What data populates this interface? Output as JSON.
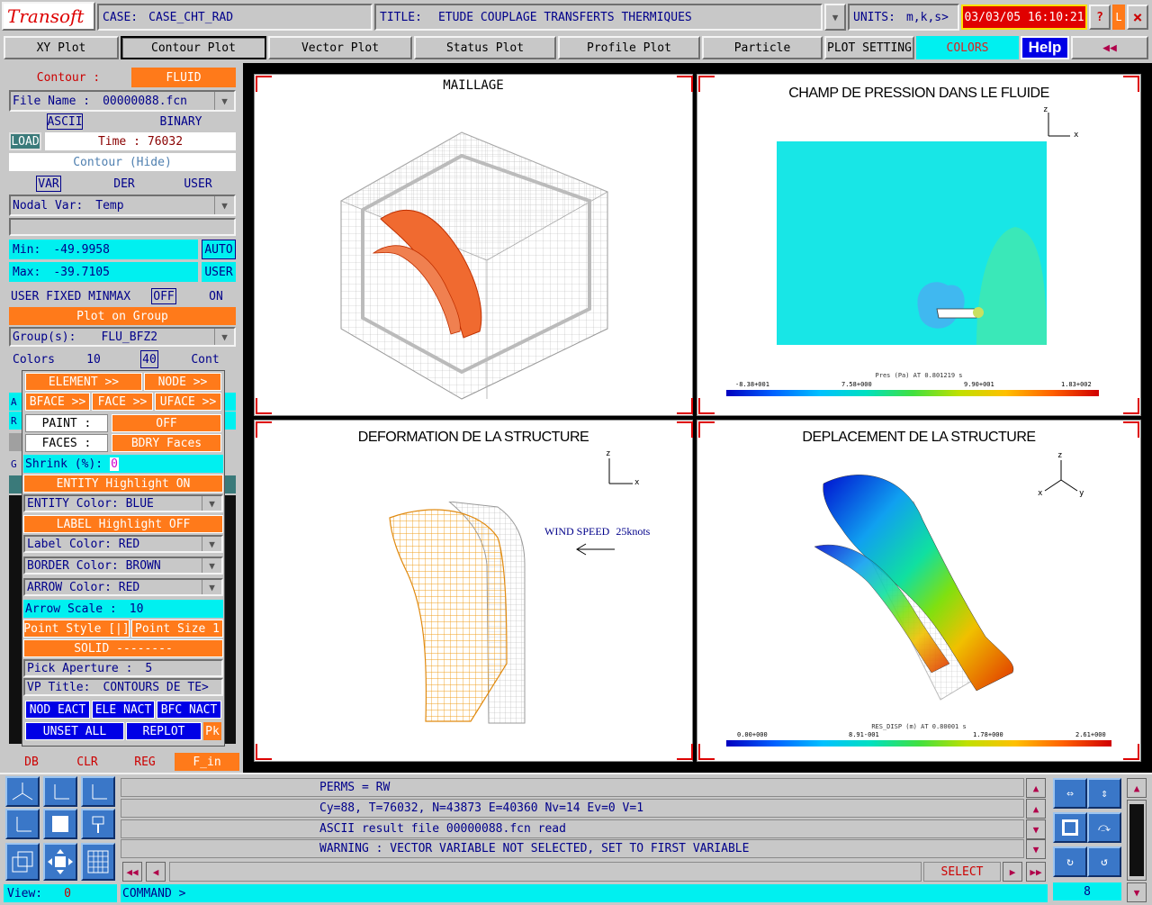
{
  "header": {
    "logo": "Transoft",
    "case_label": "CASE:",
    "case_value": "CASE_CHT_RAD",
    "title_label": "TITLE:",
    "title_value": "ETUDE COUPLAGE TRANSFERTS THERMIQUES",
    "units_label": "UNITS:",
    "units_value": "m,k,s>",
    "datetime": "03/03/05 16:10:21",
    "help_q": "?",
    "l_btn": "L",
    "close": "×"
  },
  "toolbar": {
    "tabs": [
      "XY Plot",
      "Contour Plot",
      "Vector Plot",
      "Status Plot",
      "Profile Plot",
      "Particle",
      "PLOT SETTING",
      "COLORS"
    ],
    "help": "Help",
    "back": "◀◀"
  },
  "left": {
    "contour_label": "Contour :",
    "contour_value": "FLUID",
    "file_label": "File Name :",
    "file_value": "00000088.fcn",
    "ascii": "ASCII",
    "binary": "BINARY",
    "load": "LOAD",
    "time_label": "Time :",
    "time_value": "76032",
    "contour_hide": "Contour (Hide)",
    "var": "VAR",
    "der": "DER",
    "user": "USER",
    "nodal_label": "Nodal Var:",
    "nodal_value": "Temp",
    "min_label": "Min:",
    "min_value": "-49.9958",
    "auto": "AUTO",
    "max_label": "Max:",
    "max_value": "-39.7105",
    "user2": "USER",
    "fixed_label": "USER FIXED MINMAX",
    "fixed_off": "OFF",
    "fixed_on": "ON",
    "plot_group": "Plot on Group",
    "group_label": "Group(s):",
    "group_value": "FLU_BFZ2",
    "colors_label": "Colors",
    "colors_a": "10",
    "colors_b": "40",
    "colors_c": "Cont",
    "db": "DB",
    "clr": "CLR",
    "reg": "REG",
    "fin": "F_in"
  },
  "popup": {
    "element": "ELEMENT >>",
    "node": "NODE >>",
    "bface": "BFACE >>",
    "face": "FACE >>",
    "uface": "UFACE >>",
    "paint_label": "PAINT :",
    "paint_value": "OFF",
    "faces_label": "FACES :",
    "faces_value": "BDRY Faces",
    "shrink_label": "Shrink (%):",
    "shrink_value": "0",
    "entity_hl": "ENTITY Highlight  ON",
    "entity_color": "ENTITY Color:  BLUE",
    "label_hl": "LABEL  Highlight OFF",
    "label_color": "Label  Color:  RED",
    "border_color": "BORDER Color:  BROWN",
    "arrow_color": "ARROW Color:  RED",
    "arrow_scale_label": "Arrow Scale :",
    "arrow_scale_value": "10",
    "point_style": "Point Style [|]",
    "point_size": "Point Size 1",
    "solid": "SOLID  --------",
    "pick_label": "Pick Aperture :",
    "pick_value": "5",
    "vp_title_label": "VP Title:",
    "vp_title_value": "CONTOURS DE TE>",
    "nod": "NOD EACT",
    "ele": "ELE NACT",
    "bfc": "BFC NACT",
    "unset": "UNSET ALL",
    "replot": "REPLOT",
    "pk": "Pk",
    "stub_a": "A",
    "stub_r": "R",
    "stub_g": "G"
  },
  "viewports": {
    "tl": {
      "title": "MAILLAGE"
    },
    "tr": {
      "title": "CHAMP DE PRESSION DANS LE FLUIDE",
      "legend_caption": "Pres (Pa) AT 0.801219 s",
      "ticks": [
        "-8.38+001",
        "7.58+000",
        "9.90+001",
        "1.83+002"
      ],
      "axis_z": "z",
      "axis_x": "x"
    },
    "bl": {
      "title": "DEFORMATION DE LA STRUCTURE",
      "wind_text": "WIND SPEED",
      "wind_value": "25knots",
      "axis_z": "z",
      "axis_x": "x"
    },
    "br": {
      "title": "DEPLACEMENT DE LA STRUCTURE",
      "legend_caption": "RES_DISP (m) AT 0.80001 s",
      "ticks": [
        "0.00+000",
        "8.91-001",
        "1.78+000",
        "2.61+000"
      ],
      "axis_z": "z",
      "axis_x": "x",
      "axis_y": "y"
    }
  },
  "bottom": {
    "messages": [
      "PERMS =  RW",
      "Cy=88, T=76032, N=43873 E=40360 Nv=14 Ev=0 V=1",
      "ASCII result file 00000088.fcn read",
      "WARNING : VECTOR VARIABLE NOT SELECTED, SET TO FIRST VARIABLE"
    ],
    "select": "SELECT",
    "command": "COMMAND >",
    "view_label": "View:",
    "view_value": "0",
    "view_num": "8"
  },
  "colors": {
    "accent": "#ff7a1a",
    "cyan": "#00f0f0",
    "navy": "#00008a",
    "panel": "#c8c8c8",
    "datetime_bg": "#e00000"
  }
}
